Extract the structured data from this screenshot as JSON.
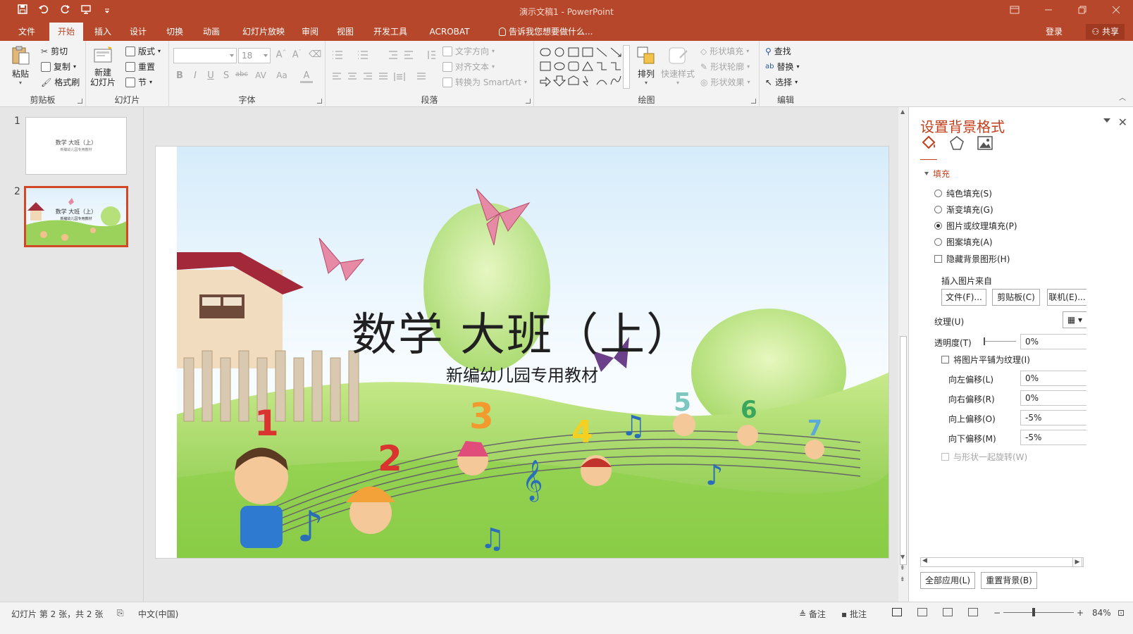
{
  "window": {
    "title": "演示文稿1 - PowerPoint"
  },
  "qat": {
    "icons": [
      "save-icon",
      "undo-icon",
      "redo-icon",
      "present-icon",
      "customize-icon"
    ]
  },
  "tabs": [
    {
      "label": "文件"
    },
    {
      "label": "开始"
    },
    {
      "label": "插入"
    },
    {
      "label": "设计"
    },
    {
      "label": "切换"
    },
    {
      "label": "动画"
    },
    {
      "label": "幻灯片放映"
    },
    {
      "label": "审阅"
    },
    {
      "label": "视图"
    },
    {
      "label": "开发工具"
    },
    {
      "label": "ACROBAT"
    }
  ],
  "active_tab": "开始",
  "tellme": "告诉我您想要做什么...",
  "account": {
    "login": "登录",
    "share": "共享"
  },
  "ribbon": {
    "clipboard": {
      "label": "剪贴板",
      "paste": "粘贴",
      "cut": "剪切",
      "copy": "复制",
      "format_painter": "格式刷"
    },
    "slides": {
      "label": "幻灯片",
      "new_slide_line1": "新建",
      "new_slide_line2": "幻灯片",
      "layout": "版式",
      "reset": "重置",
      "section": "节"
    },
    "font": {
      "label": "字体",
      "font_name": "",
      "font_size": "18",
      "bold": "B",
      "italic": "I",
      "underline": "U",
      "shadow": "S",
      "strike": "abc",
      "spacing": "AV",
      "case": "Aa",
      "color": "A"
    },
    "paragraph": {
      "label": "段落",
      "text_direction": "文字方向",
      "align_text": "对齐文本",
      "smartart": "转换为 SmartArt"
    },
    "drawing": {
      "label": "绘图",
      "arrange": "排列",
      "quick_styles": "快速样式",
      "shape_fill": "形状填充",
      "shape_outline": "形状轮廓",
      "shape_effects": "形状效果"
    },
    "editing": {
      "label": "编辑",
      "find": "查找",
      "replace": "替换",
      "select": "选择"
    }
  },
  "thumbnails": [
    {
      "number": "1",
      "title": "数学 大班（上）",
      "subtitle": "新编幼儿园专用教材"
    },
    {
      "number": "2",
      "title": "数学 大班（上）",
      "subtitle": "新编幼儿园专用教材"
    }
  ],
  "slide": {
    "title": "数学  大班（上）",
    "subtitle": "新编幼儿园专用教材"
  },
  "pane": {
    "title": "设置背景格式",
    "section": "填充",
    "fill_options": [
      {
        "label": "纯色填充(S)",
        "selected": false
      },
      {
        "label": "渐变填充(G)",
        "selected": false
      },
      {
        "label": "图片或纹理填充(P)",
        "selected": true
      },
      {
        "label": "图案填充(A)",
        "selected": false
      }
    ],
    "hide_bg": "隐藏背景图形(H)",
    "insert_from": "插入图片来自",
    "btn_file": "文件(F)...",
    "btn_clipboard": "剪贴板(C)",
    "btn_online": "联机(E)...",
    "texture": "纹理(U)",
    "transparency": {
      "label": "透明度(T)",
      "value": "0%"
    },
    "tile": "将图片平铺为纹理(I)",
    "offsets": [
      {
        "label": "向左偏移(L)",
        "value": "0%"
      },
      {
        "label": "向右偏移(R)",
        "value": "0%"
      },
      {
        "label": "向上偏移(O)",
        "value": "-5%"
      },
      {
        "label": "向下偏移(M)",
        "value": "-5%"
      }
    ],
    "rotate_with_shape": "与形状一起旋转(W)",
    "apply_all": "全部应用(L)",
    "reset_bg": "重置背景(B)"
  },
  "status": {
    "slide_info": "幻灯片 第 2 张，共 2 张",
    "language": "中文(中国)",
    "notes": "备注",
    "comments": "批注",
    "zoom": "84%"
  },
  "colors": {
    "accent": "#b7472a",
    "pane_title": "#c43e1c"
  }
}
